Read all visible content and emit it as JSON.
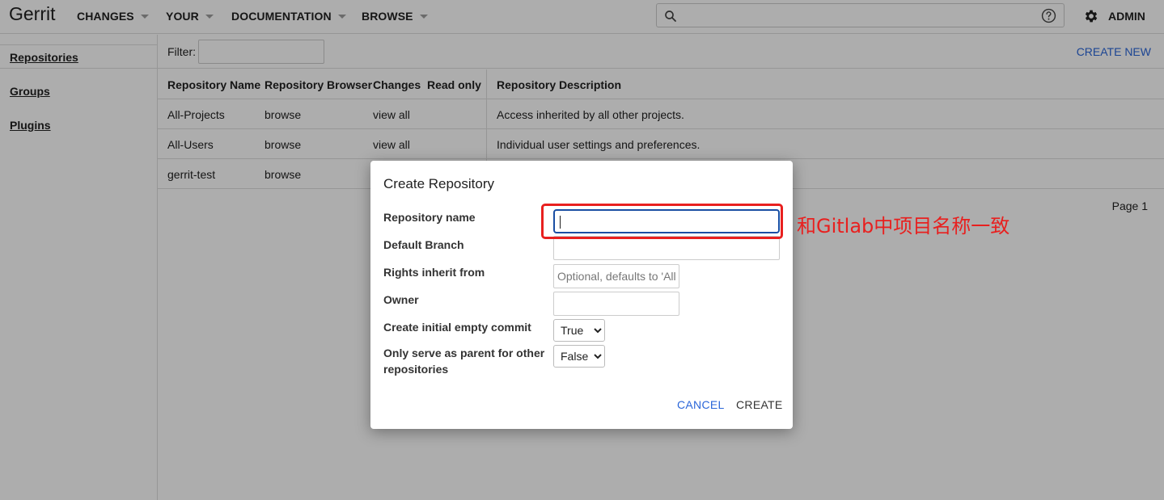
{
  "header": {
    "brand": "Gerrit",
    "nav": [
      "CHANGES",
      "YOUR",
      "DOCUMENTATION",
      "BROWSE"
    ],
    "search_placeholder": "",
    "admin_label": "ADMIN",
    "icons": [
      "search-icon",
      "help-icon",
      "gear-icon"
    ]
  },
  "sidebar": {
    "items": [
      {
        "label": "Repositories"
      },
      {
        "label": "Groups"
      },
      {
        "label": "Plugins"
      }
    ]
  },
  "main": {
    "filter_label": "Filter:",
    "filter_value": "",
    "create_new_label": "CREATE NEW",
    "columns": [
      "Repository Name",
      "Repository Browser",
      "Changes",
      "Read only",
      "Repository Description"
    ],
    "rows": [
      {
        "name": "All-Projects",
        "browser": "browse",
        "changes": "view all",
        "read_only": "",
        "description": "Access inherited by all other projects."
      },
      {
        "name": "All-Users",
        "browser": "browse",
        "changes": "view all",
        "read_only": "",
        "description": "Individual user settings and preferences."
      },
      {
        "name": "gerrit-test",
        "browser": "browse",
        "changes": "",
        "read_only": "",
        "description": ""
      }
    ],
    "page_label": "Page 1"
  },
  "dialog": {
    "title": "Create Repository",
    "fields": {
      "repo_name_label": "Repository name",
      "repo_name_value": "",
      "default_branch_label": "Default Branch",
      "default_branch_value": "",
      "rights_label": "Rights inherit from",
      "rights_placeholder": "Optional, defaults to 'All-Projects'",
      "owner_label": "Owner",
      "owner_value": "",
      "empty_commit_label": "Create initial empty commit",
      "empty_commit_value": "True",
      "parent_only_label_line1": "Only serve as parent for other",
      "parent_only_label_line2": "repositories",
      "parent_only_value": "False"
    },
    "cancel_label": "CANCEL",
    "create_label": "CREATE"
  },
  "annotation": {
    "text": "和Gitlab中项目名称一致",
    "color": "#e8201f"
  },
  "colors": {
    "link_blue": "#2a66d9",
    "focus_blue": "#1a4ea3"
  }
}
